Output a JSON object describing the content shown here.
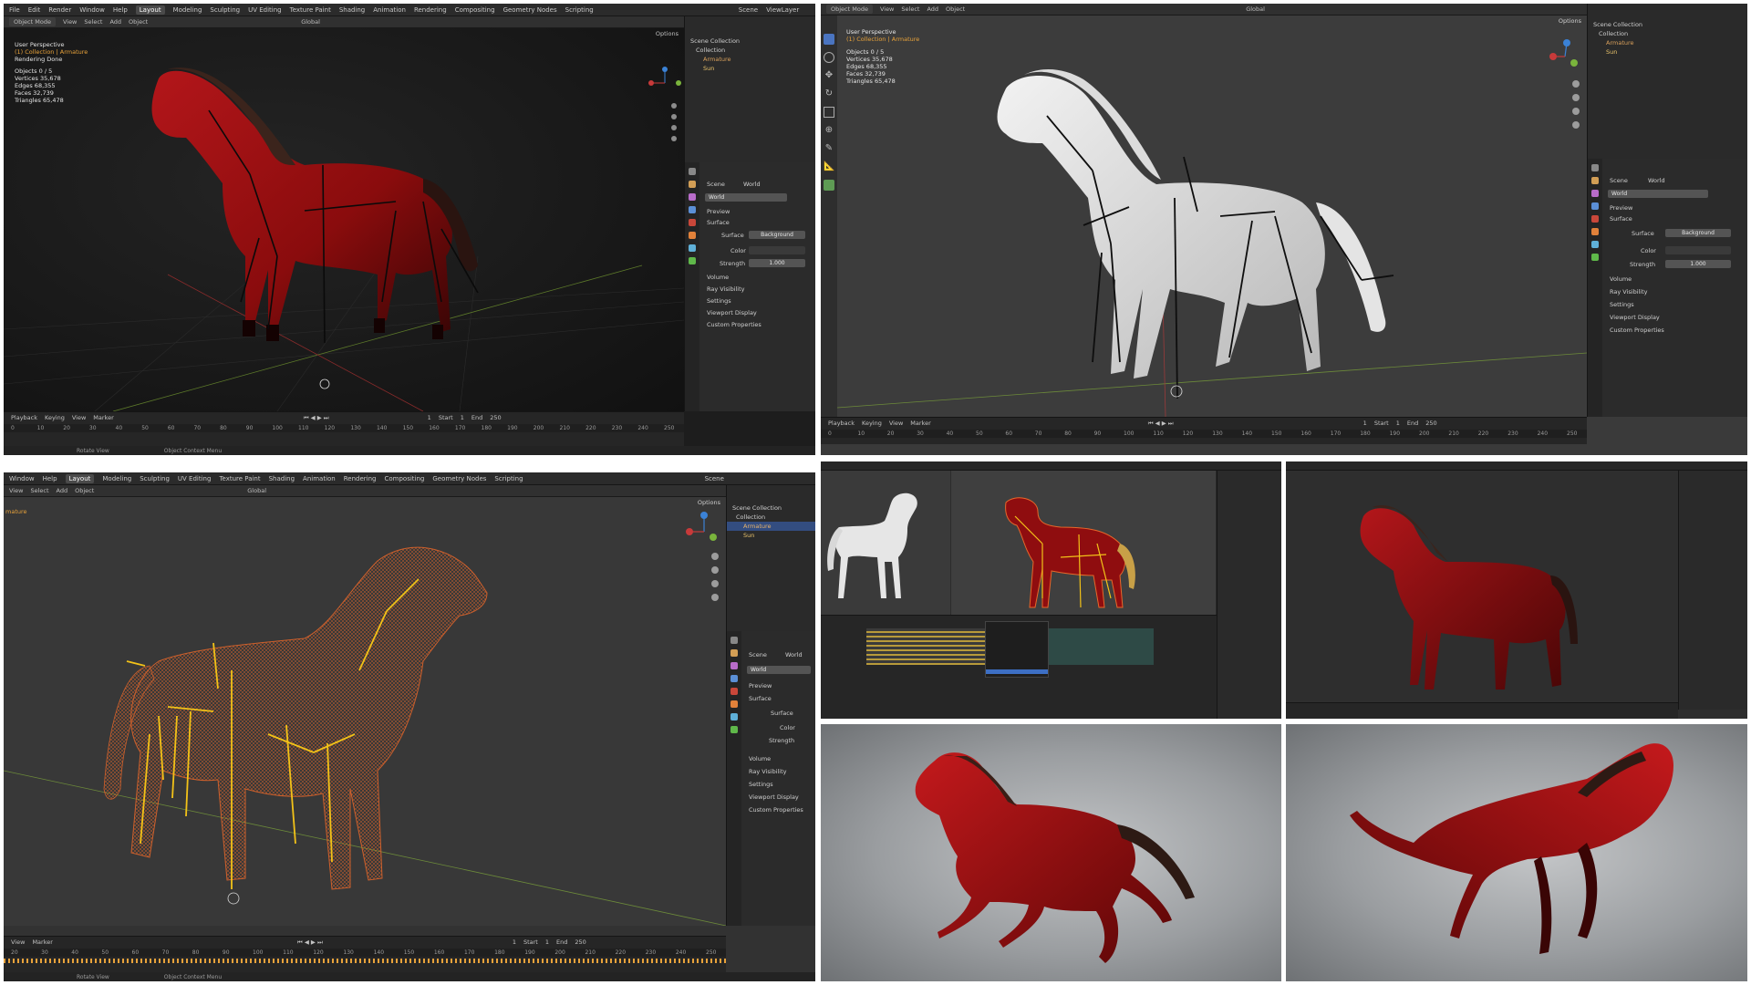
{
  "colors": {
    "horse_red": "#9a0f10",
    "horse_dark": "#3a0707",
    "wire_orange": "#e8672a",
    "bone_yellow": "#f2c218",
    "select_blue": "#334d80",
    "bg_dark": "#1d1d1d"
  },
  "panel_tl": {
    "menu": [
      "File",
      "Edit",
      "Render",
      "Window",
      "Help"
    ],
    "workspaces": [
      "Layout",
      "Modeling",
      "Sculpting",
      "UV Editing",
      "Texture Paint",
      "Shading",
      "Animation",
      "Rendering",
      "Compositing",
      "Geometry Nodes",
      "Scripting"
    ],
    "active_workspace": "Layout",
    "scene": "Scene",
    "view_layer": "ViewLayer",
    "mode": "Object Mode",
    "header_menu": [
      "View",
      "Select",
      "Add",
      "Object"
    ],
    "orientation": "Global",
    "options": "Options",
    "vp_title": "User Perspective",
    "vp_collection": "(1) Collection | Armature",
    "vp_status": "Rendering Done",
    "stats": [
      "Objects   0 / 5",
      "Vertices  35,678",
      "Edges     68,355",
      "Faces     32,739",
      "Triangles 65,478"
    ],
    "outliner": [
      "Scene Collection",
      "Collection",
      "Armature",
      "Sun"
    ],
    "props": {
      "scene": "Scene",
      "world_crumb": "World",
      "world": "World",
      "sections": [
        "Preview",
        "Surface",
        "Volume",
        "Ray Visibility",
        "Settings",
        "Viewport Display",
        "Custom Properties"
      ],
      "surface_label": "Surface",
      "surface_value": "Background",
      "color_label": "Color",
      "strength_label": "Strength",
      "strength_value": "1.000"
    },
    "timeline_menu": [
      "Playback",
      "Keying",
      "View",
      "Marker"
    ],
    "frame": "1",
    "start_label": "Start",
    "start": "1",
    "end_label": "End",
    "end": "250",
    "ticks": [
      "0",
      "10",
      "20",
      "30",
      "40",
      "50",
      "60",
      "70",
      "80",
      "90",
      "100",
      "110",
      "120",
      "130",
      "140",
      "150",
      "160",
      "170",
      "180",
      "190",
      "200",
      "210",
      "220",
      "230",
      "240",
      "250"
    ],
    "status": [
      "Rotate View",
      "Object Context Menu"
    ]
  },
  "panel_tr": {
    "mode": "Object Mode",
    "header_menu": [
      "View",
      "Select",
      "Add",
      "Object"
    ],
    "orientation": "Global",
    "options": "Options",
    "vp_title": "User Perspective",
    "vp_collection": "(1) Collection | Armature",
    "stats": [
      "Objects   0 / 5",
      "Vertices  35,678",
      "Edges     68,355",
      "Faces     32,739",
      "Triangles 65,478"
    ],
    "outliner": [
      "Scene Collection",
      "Collection",
      "Armature",
      "Sun"
    ],
    "props": {
      "scene": "Scene",
      "world_crumb": "World",
      "world": "World",
      "sections": [
        "Preview",
        "Surface",
        "Volume",
        "Ray Visibility",
        "Settings",
        "Viewport Display",
        "Custom Properties"
      ],
      "surface_label": "Surface",
      "surface_value": "Background",
      "color_label": "Color",
      "strength_label": "Strength",
      "strength_value": "1.000"
    },
    "timeline_menu": [
      "Playback",
      "Keying",
      "View",
      "Marker"
    ],
    "frame": "1",
    "start_label": "Start",
    "start": "1",
    "end_label": "End",
    "end": "250",
    "ticks": [
      "0",
      "10",
      "20",
      "30",
      "40",
      "50",
      "60",
      "70",
      "80",
      "90",
      "100",
      "110",
      "120",
      "130",
      "140",
      "150",
      "160",
      "170",
      "180",
      "190",
      "200",
      "210",
      "220",
      "230",
      "240",
      "250"
    ]
  },
  "panel_bl": {
    "menu": [
      "Window",
      "Help"
    ],
    "workspaces": [
      "Layout",
      "Modeling",
      "Sculpting",
      "UV Editing",
      "Texture Paint",
      "Shading",
      "Animation",
      "Rendering",
      "Compositing",
      "Geometry Nodes",
      "Scripting"
    ],
    "active_workspace": "Layout",
    "scene": "Scene",
    "header_menu": [
      "View",
      "Select",
      "Add",
      "Object"
    ],
    "orientation": "Global",
    "options": "Options",
    "vp_fragment": "mature",
    "outliner": [
      "Scene Collection",
      "Collection",
      "Armature",
      "Sun"
    ],
    "props": {
      "scene": "Scene",
      "world_crumb": "World",
      "world": "World",
      "sections": [
        "Preview",
        "Surface",
        "Volume",
        "Ray Visibility",
        "Settings",
        "Viewport Display",
        "Custom Properties"
      ],
      "surface_label": "Surface",
      "color_label": "Color",
      "strength_label": "Strength"
    },
    "timeline_menu": [
      "View",
      "Marker"
    ],
    "frame": "1",
    "start_label": "Start",
    "start": "1",
    "end_label": "End",
    "end": "250",
    "ticks": [
      "20",
      "30",
      "40",
      "50",
      "60",
      "70",
      "80",
      "90",
      "100",
      "110",
      "120",
      "130",
      "140",
      "150",
      "160",
      "170",
      "180",
      "190",
      "200",
      "210",
      "220",
      "230",
      "240",
      "250"
    ],
    "status": [
      "Rotate View",
      "Object Context Menu"
    ]
  }
}
